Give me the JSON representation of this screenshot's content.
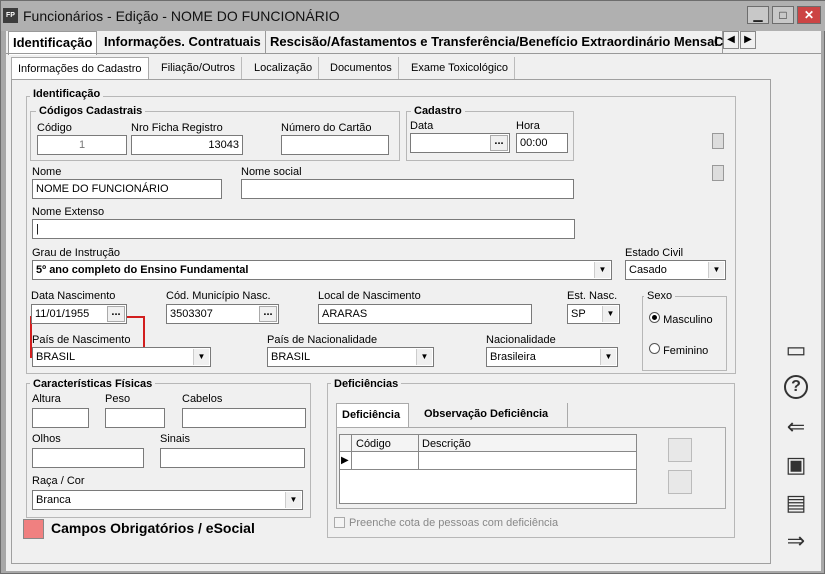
{
  "window": {
    "title": "Funcionários - Edição - NOME DO FUNCIONÁRIO",
    "app_badge": "FP",
    "minimize": "▁",
    "maximize": "□",
    "close": "✕"
  },
  "tabs": [
    {
      "label": "Identificação"
    },
    {
      "label": "Informações. Contratuais"
    },
    {
      "label": "Rescisão/Afastamentos e Transferência/Benefício Extraordinário Mensal"
    },
    {
      "label": "C"
    }
  ],
  "tab_scroll": {
    "left": "◀",
    "right": "▶"
  },
  "subtabs": [
    {
      "label": "Informações do Cadastro"
    },
    {
      "label": "Filiação/Outros"
    },
    {
      "label": "Localização"
    },
    {
      "label": "Documentos"
    },
    {
      "label": "Exame Toxicológico"
    }
  ],
  "identificacao": {
    "section_title": "Identificação",
    "codigos": {
      "title": "Códigos Cadastrais",
      "codigo_label": "Código",
      "codigo_value": "1",
      "ficha_label": "Nro Ficha Registro",
      "ficha_value": "13043",
      "cartao_label": "Número do Cartão",
      "cartao_value": ""
    },
    "cadastro": {
      "title": "Cadastro",
      "data_label": "Data",
      "data_value": "",
      "hora_label": "Hora",
      "hora_value": "00:00"
    },
    "nome_label": "Nome",
    "nome_value": "NOME DO FUNCIONÁRIO",
    "nome_social_label": "Nome social",
    "nome_social_value": "",
    "nome_extenso_label": "Nome Extenso",
    "nome_extenso_value": "|",
    "grau_label": "Grau de Instrução",
    "grau_value": "5º ano completo do Ensino Fundamental",
    "estado_civil_label": "Estado Civil",
    "estado_civil_value": "Casado",
    "data_nasc_label": "Data Nascimento",
    "data_nasc_value": "11/01/1955",
    "cod_mun_label": "Cód. Município Nasc.",
    "cod_mun_value": "3503307",
    "local_nasc_label": "Local de Nascimento",
    "local_nasc_value": "ARARAS",
    "est_nasc_label": "Est. Nasc.",
    "est_nasc_value": "SP",
    "sexo": {
      "title": "Sexo",
      "masculino": "Masculino",
      "feminino": "Feminino",
      "selected": "Masculino"
    },
    "pais_nasc_label": "País de Nascimento",
    "pais_nasc_value": "BRASIL",
    "pais_nac_label": "País de Nacionalidade",
    "pais_nac_value": "BRASIL",
    "nacionalidade_label": "Nacionalidade",
    "nacionalidade_value": "Brasileira"
  },
  "caracteristicas": {
    "title": "Características Físicas",
    "altura_label": "Altura",
    "peso_label": "Peso",
    "cabelos_label": "Cabelos",
    "olhos_label": "Olhos",
    "sinais_label": "Sinais",
    "raca_label": "Raça / Cor",
    "raca_value": "Branca"
  },
  "deficiencias": {
    "title": "Deficiências",
    "tab_deficiencia": "Deficiência",
    "tab_observacao": "Observação Deficiência",
    "col_codigo": "Código",
    "col_descricao": "Descrição",
    "cota_label": "Preenche cota de pessoas com deficiência"
  },
  "legend": {
    "text": "Campos Obrigatórios / eSocial",
    "color": "#f08080"
  },
  "sidebar_icons": [
    "monitor-icon",
    "help-icon",
    "back-arrow-icon",
    "save-icon",
    "document-check-icon",
    "forward-arrow-icon"
  ],
  "sidebar_glyphs": {
    "monitor": "▭",
    "help": "?",
    "back": "⇐",
    "save": "▣",
    "doc": "▤",
    "forward": "⇒"
  },
  "dropdown_glyph": "▼",
  "dots_glyph": "...",
  "record_marker": "▶",
  "colors": {
    "highlight": "#d21e1e",
    "required": "#f08080"
  }
}
